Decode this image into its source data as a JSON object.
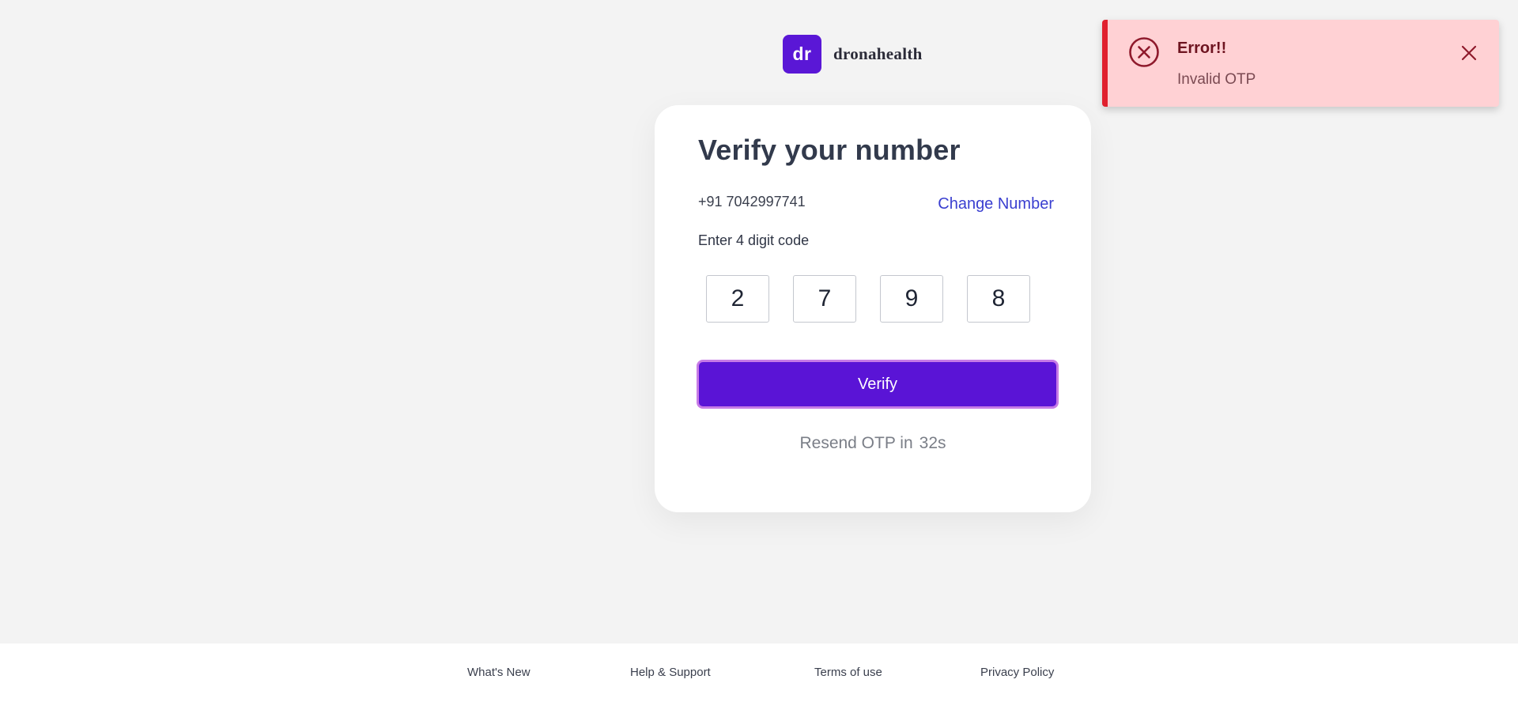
{
  "brand": {
    "logo_text": "dr",
    "name": "dronahealth",
    "color": "#5a17d6"
  },
  "verify": {
    "title": "Verify your number",
    "phone": "+91 7042997741",
    "change_number_label": "Change Number",
    "code_label": "Enter 4 digit code",
    "otp_digits": [
      "2",
      "7",
      "9",
      "8"
    ],
    "verify_button_label": "Verify",
    "resend_label": "Resend OTP in",
    "resend_timer": "32s"
  },
  "toast": {
    "type": "error",
    "title": "Error!!",
    "message": "Invalid OTP",
    "accent_color": "#e0202e",
    "icon": "error-circle-x-icon",
    "close_icon": "close-icon"
  },
  "footer": {
    "links": [
      "What's New",
      "Help & Support",
      "Terms of use",
      "Privacy Policy"
    ]
  }
}
